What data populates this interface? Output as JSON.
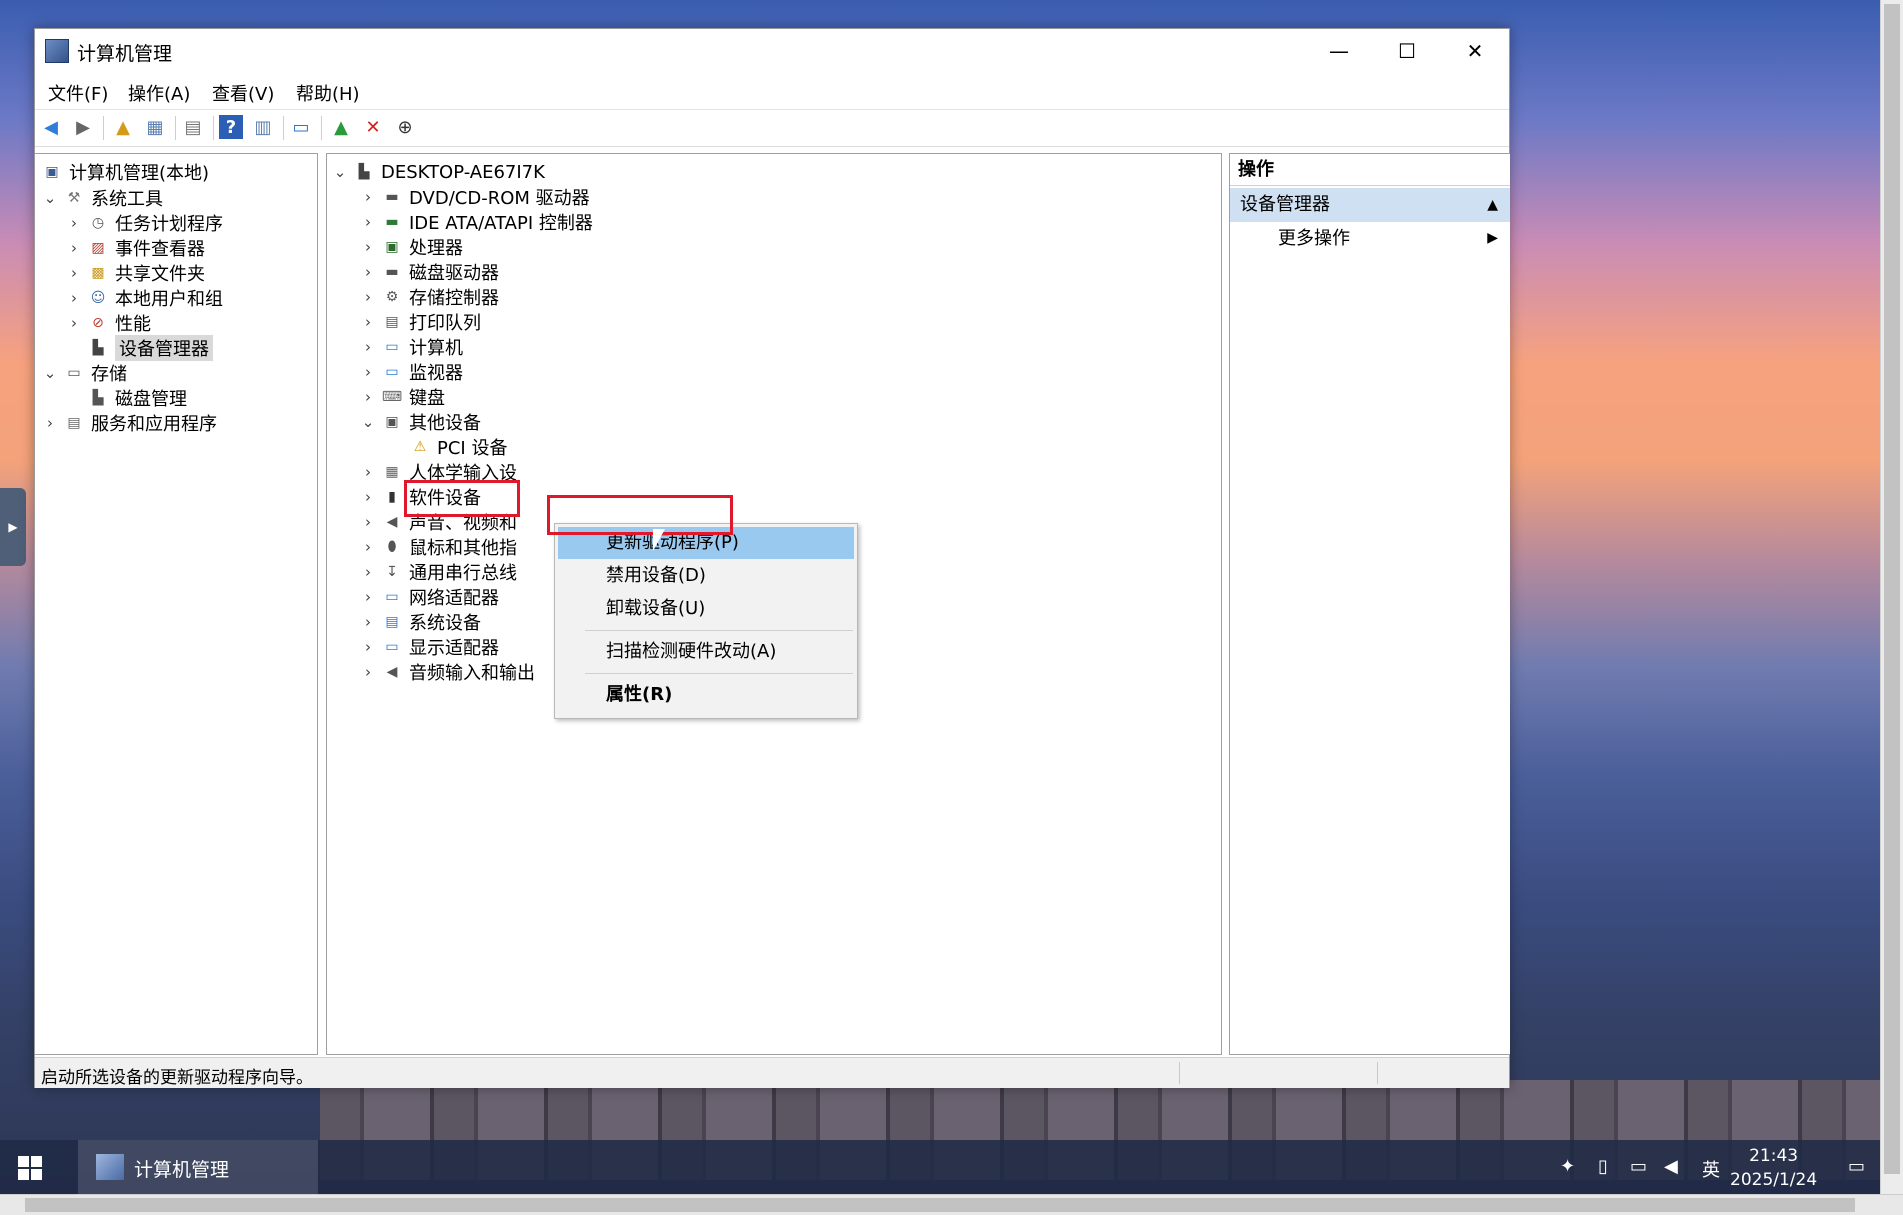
{
  "window": {
    "title": "计算机管理",
    "controls": {
      "minimize": "—",
      "maximize": "☐",
      "close": "✕"
    }
  },
  "menu": [
    "文件(F)",
    "操作(A)",
    "查看(V)",
    "帮助(H)"
  ],
  "left_tree": {
    "root": "计算机管理(本地)",
    "system_tools": "系统工具",
    "system_children": [
      "任务计划程序",
      "事件查看器",
      "共享文件夹",
      "本地用户和组",
      "性能",
      "设备管理器"
    ],
    "storage": "存储",
    "storage_children": [
      "磁盘管理"
    ],
    "services": "服务和应用程序"
  },
  "device_tree": {
    "root": "DESKTOP-AE67I7K",
    "items": [
      "DVD/CD-ROM 驱动器",
      "IDE ATA/ATAPI 控制器",
      "处理器",
      "磁盘驱动器",
      "存储控制器",
      "打印队列",
      "计算机",
      "监视器",
      "键盘",
      "其他设备"
    ],
    "other_child": "PCI 设备",
    "items_after": [
      "人体学输入设",
      "软件设备",
      "声音、视频和",
      "鼠标和其他指",
      "通用串行总线",
      "网络适配器",
      "系统设备",
      "显示适配器",
      "音频输入和输出"
    ]
  },
  "actions": {
    "header": "操作",
    "section": "设备管理器",
    "more": "更多操作"
  },
  "context_menu": {
    "update": "更新驱动程序(P)",
    "disable": "禁用设备(D)",
    "uninstall": "卸载设备(U)",
    "scan": "扫描检测硬件改动(A)",
    "properties": "属性(R)"
  },
  "status": "启动所选设备的更新驱动程序向导。",
  "taskbar": {
    "app": "计算机管理",
    "ime": "英",
    "time": "21:43",
    "date": "2025/1/24"
  },
  "colors": {
    "highlight": "#99c9ef",
    "callout": "#e0182c",
    "section": "#cfe0f2"
  }
}
